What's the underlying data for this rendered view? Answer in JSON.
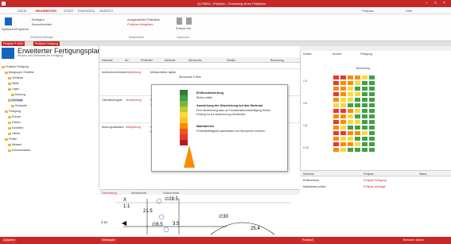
{
  "window": {
    "title": "IQ-FMEA - Prüfplan – Erstellung eines Prüfplans",
    "controls": [
      "–",
      "□",
      "×"
    ]
  },
  "ribbon_tabs": [
    "DATEI",
    "BEARBEITEN",
    "START",
    "EINFÜGEN",
    "ANSICHT"
  ],
  "ribbon_tabs_right": [
    "Prüfplan",
    "Hilfe"
  ],
  "ribbon": {
    "buttons": [
      "Speichern",
      "Kopieren",
      "Einfügen",
      "Ausschneiden",
      "Zurück",
      "Vor"
    ],
    "groups": [
      "Zwischenablage",
      "Bearbeiten",
      "Optionen"
    ],
    "mid_text_1": "Ausgewählte Prüfpläne",
    "mid_text_2": "Prüfplan freigeben"
  },
  "doc_tabs": [
    "Prüfplan P-0815",
    "Prüfplan-Fertigung"
  ],
  "left": {
    "title": "Erweiterter Fertigungsplan",
    "subtitle": "Struktur und Merkmale der Fertigung",
    "tree": [
      "Prüfplan Fertigung",
      "Baugruppe Getriebe",
      "Gehäuse",
      "Welle",
      "Lager",
      "Bohrung",
      "Montage",
      "Schraube",
      "Fertigung",
      "Drehen",
      "Fräsen",
      "Schleifen",
      "Härten",
      "Prüfen",
      "Messen",
      "Dokumentation"
    ],
    "selected_index": 6
  },
  "table": {
    "headers": [
      "Merkmal",
      "Art",
      "Prüfmittel",
      "Methode",
      "Stichprobe",
      "Details",
      "Bewertung"
    ],
    "rows": [
      {
        "c1": "Außendurchmesser",
        "c2": "Maßprüfung",
        "c3": "Messschieber digital",
        "c4": "Stichprobe 5 Teile"
      },
      {
        "c1": "Oberflächengüte",
        "c2": "Sichtprüfung",
        "c3": "Rauheitsmessgerät",
        "c4": "100% Prüfung"
      },
      {
        "c1": "Bohrungsabstand",
        "c2": "Maßprüfung",
        "c3": "Koordinatenmessung",
        "c4": "Erstmuster"
      }
    ]
  },
  "popup": {
    "heading1": "Einflussbewertung",
    "line1": "Risiko: mittel",
    "heading2": "Auswirkung der Abweichung auf das Merkmal",
    "line2": "Eine Abweichung kann zu Funktionsbeeinträchtigung führen.",
    "line3": "Prüfung ist zur Absicherung erforderlich.",
    "heading3": "Maßnahmen",
    "line4": "Prüfmittelfähigkeit nachweisen und Stichprobe erhöhen."
  },
  "right": {
    "header_labels": [
      "Details",
      "Ansicht",
      "Fertigung"
    ],
    "matrix_title": "Bewertung",
    "row_labels": [
      "1-3",
      "4-6",
      "7-8",
      "9-10"
    ]
  },
  "bottom_right": {
    "headers": [
      "Merkmal",
      "Prüfplan",
      "Status"
    ],
    "rows": [
      {
        "a": "Prüfmerkmal",
        "b": "Prüfplan Fertigung"
      },
      {
        "a": "Maßnahme prüfen",
        "b": "Prüfplan Montage"
      }
    ]
  },
  "drawing": {
    "tabs": [
      "Zeichnung",
      "Messwerte",
      "Dokumente"
    ],
    "annotations": [
      "X",
      "1:1",
      "21.5",
      "∅28.5",
      "3.15",
      "∅8.5",
      "3.5",
      "∅30",
      "25.4"
    ]
  },
  "status": {
    "tabs": [
      "Aufgaben",
      "Meldungen",
      "Protokoll"
    ],
    "right_text": "Benutzer: Admin"
  },
  "colors": {
    "brand": "#c62828",
    "heat_red": "#e53935",
    "heat_orange": "#fb8c00",
    "heat_yellow": "#fdd835",
    "heat_green": "#43a047",
    "selection": "#cfe3ff"
  }
}
